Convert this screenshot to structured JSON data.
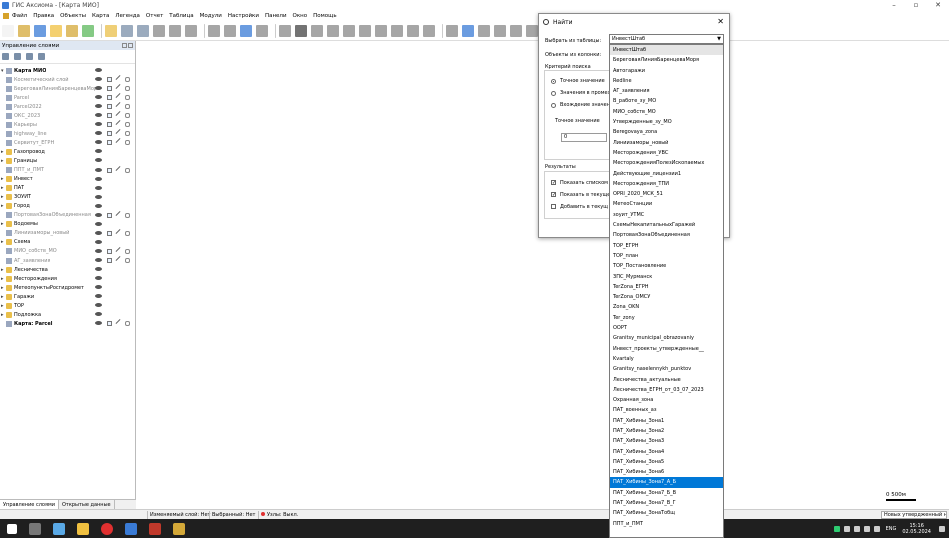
{
  "window": {
    "title": "ГИС Аксиома - [Карта МИО]"
  },
  "menu": [
    "Файл",
    "Правка",
    "Объекты",
    "Карта",
    "Легенда",
    "Отчет",
    "Таблица",
    "Модули",
    "Настройки",
    "Панели",
    "Окно",
    "Помощь"
  ],
  "left_panel": {
    "title": "Управление слоями",
    "layers": [
      {
        "name": "Карта МИО",
        "style": "bold",
        "exp": "▾",
        "icon": "grid"
      },
      {
        "name": "Косметический слой",
        "style": "gray",
        "exp": "",
        "icon": "grid"
      },
      {
        "name": "БереговаяЛинияБаренцеваМоря",
        "style": "gray",
        "exp": "",
        "icon": "grid"
      },
      {
        "name": "Parcel",
        "style": "gray",
        "exp": "",
        "icon": "grid"
      },
      {
        "name": "Parcel2022",
        "style": "gray",
        "exp": "",
        "icon": "grid"
      },
      {
        "name": "ОКС_2023",
        "style": "gray",
        "exp": "",
        "icon": "grid"
      },
      {
        "name": "Карьеры",
        "style": "gray",
        "exp": "",
        "icon": "grid"
      },
      {
        "name": "highway_line",
        "style": "gray",
        "exp": "",
        "icon": "grid"
      },
      {
        "name": "Сервитут_ЕГРН",
        "style": "gray",
        "exp": "",
        "icon": "grid"
      },
      {
        "name": "Газопровод",
        "style": "",
        "exp": "▸",
        "icon": "folder"
      },
      {
        "name": "Границы",
        "style": "",
        "exp": "▸",
        "icon": "folder"
      },
      {
        "name": "ППТ_и_ПМТ",
        "style": "gray",
        "exp": "",
        "icon": "grid"
      },
      {
        "name": "Инвест",
        "style": "",
        "exp": "▸",
        "icon": "folder"
      },
      {
        "name": "ПАТ",
        "style": "",
        "exp": "▸",
        "icon": "folder"
      },
      {
        "name": "ЗОУИТ",
        "style": "",
        "exp": "▸",
        "icon": "folder"
      },
      {
        "name": "Город",
        "style": "",
        "exp": "▸",
        "icon": "folder"
      },
      {
        "name": "ПортоваяЗонаОбъединенная",
        "style": "gray",
        "exp": "",
        "icon": "grid"
      },
      {
        "name": "Водоемы",
        "style": "",
        "exp": "▸",
        "icon": "folder"
      },
      {
        "name": "Линиизаморы_новый",
        "style": "gray",
        "exp": "",
        "icon": "grid"
      },
      {
        "name": "Схема",
        "style": "",
        "exp": "▸",
        "icon": "folder"
      },
      {
        "name": "МИО_собств_МО",
        "style": "gray",
        "exp": "",
        "icon": "grid"
      },
      {
        "name": "АГ_заявления",
        "style": "gray",
        "exp": "",
        "icon": "grid"
      },
      {
        "name": "Лесничества",
        "style": "",
        "exp": "▸",
        "icon": "folder"
      },
      {
        "name": "Месторождения",
        "style": "",
        "exp": "▸",
        "icon": "folder"
      },
      {
        "name": "МетеопунктыРосгидромет",
        "style": "",
        "exp": "▸",
        "icon": "folder"
      },
      {
        "name": "Гаражи",
        "style": "",
        "exp": "▸",
        "icon": "folder"
      },
      {
        "name": "ТОР",
        "style": "",
        "exp": "▸",
        "icon": "folder"
      },
      {
        "name": "Подложка",
        "style": "",
        "exp": "▸",
        "icon": "folder"
      },
      {
        "name": "Карта: Parcel",
        "style": "bold",
        "exp": "",
        "icon": "grid"
      }
    ],
    "tabs": [
      "Управление слоями",
      "Открытые данные"
    ]
  },
  "dialog": {
    "title": "Найти",
    "select_table_label": "Выбрать из таблицы:",
    "selected_table": "ИнвестШтаб",
    "objects_from_column_label": "Объекты из колонки:",
    "search_criterion_label": "Критерий поиска",
    "radio_exact": "Точное значение",
    "radio_range": "Значения в промеж",
    "radio_contains": "Вхождение значени",
    "exact_value_label": "Точное значение",
    "exact_value": "0",
    "results_label": "Результаты",
    "check_show_list": "Показать списком",
    "check_show_current": "Показать в текуще",
    "check_add_to_current": "Добавить в текущ"
  },
  "dropdown_items": [
    "ИнвестШтаб",
    "БереговаяЛинияБаренцеваМоря",
    "Автогаражи",
    "Redline",
    "АГ_заявления",
    "В_работе_зу_МО",
    "МИО_собств_МО",
    "Утвержденные_зу_МО",
    "Beregovaya_zona",
    "Линиизаморы_новый",
    "Месторождения_УВС",
    "МесторожденияПолезИскопаемых",
    "Действующие_лицензии1",
    "Месторождения_ТПИ",
    "OPRI_2020_МСК_51",
    "МетеоСтанции",
    "зоуит_УТМС",
    "СхемыНекапитальныхГаражей",
    "ПортоваяЗонаОбъединенная",
    "ТОР_ЕГРН",
    "ТОР_план",
    "ТОР_Постановление",
    "ЗПС_Мурманск",
    "TerZona_ЕГРН",
    "TerZona_ОМСУ",
    "Zona_OKN",
    "Ter_zony",
    "OOPT",
    "Granitsy_municipal_obrazovaniy",
    "Инвест_проекты_утвержденные__",
    "Kvartaly",
    "Granitsy_naselennykh_punktov",
    "Лесничества_актуальные",
    "Лесничества_ЕГРН_от_03_07_2023",
    "Охранная_зона",
    "ПАТ_военных_аз",
    "ПАТ_Хибины_Зона1",
    "ПАТ_Хибины_Зона2",
    "ПАТ_Хибины_Зона3",
    "ПАТ_Хибины_Зона4",
    "ПАТ_Хибины_Зона5",
    "ПАТ_Хибины_Зона6",
    "ПАТ_Хибины_Зона7_А_Б",
    "ПАТ_Хибины_Зона7_Б_В",
    "ПАТ_Хибины_Зона7_В_Г",
    "ПАТ_Хибины_ЗонаТобщ",
    "ППТ_и_ПМТ"
  ],
  "highlighted_index": 42,
  "status": {
    "editable_layer": "Изменяемый слой: Нет",
    "selected": "Выбранный: Нет",
    "nodes": "Узлы: Выкл.",
    "right_field": "Новых утвердженный н"
  },
  "scale": {
    "label": "0 500м"
  },
  "taskbar": {
    "lang": "ENG",
    "time": "15:16",
    "date": "02.05.2024"
  }
}
